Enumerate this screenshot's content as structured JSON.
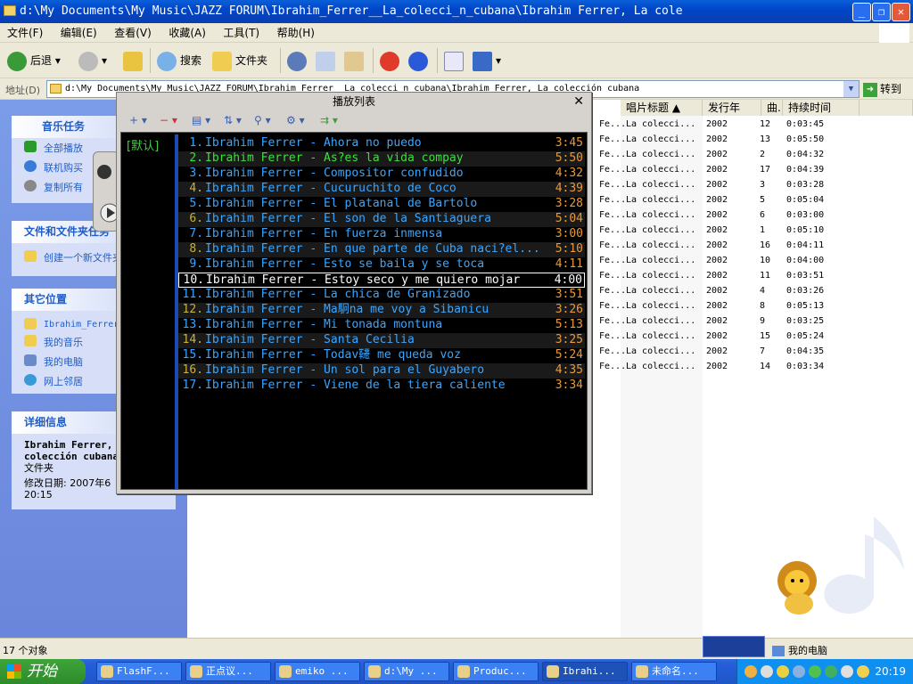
{
  "window": {
    "title": "d:\\My Documents\\My Music\\JAZZ FORUM\\Ibrahim_Ferrer__La_colecci_n_cubana\\Ibrahim Ferrer, La cole",
    "buttons": {
      "min": "_",
      "max": "❐",
      "close": "✕"
    }
  },
  "menu": [
    "文件(F)",
    "编辑(E)",
    "查看(V)",
    "收藏(A)",
    "工具(T)",
    "帮助(H)"
  ],
  "toolbar": {
    "back": "后退",
    "search": "搜索",
    "folders": "文件夹"
  },
  "address": {
    "label": "地址(D)",
    "value": "d:\\My Documents\\My Music\\JAZZ FORUM\\Ibrahim_Ferrer__La_colecci_n_cubana\\Ibrahim Ferrer, La colección cubana",
    "go": "转到"
  },
  "taskpane": {
    "music_tasks": {
      "title": "音乐任务",
      "items": [
        "全部播放",
        "联机购买",
        "复制所有"
      ]
    },
    "file_tasks": {
      "title": "文件和文件夹任务",
      "items": [
        "创建一个新文件夹"
      ]
    },
    "other_places": {
      "title": "其它位置",
      "items": [
        "Ibrahim_Ferrer",
        "我的音乐",
        "我的电脑",
        "网上邻居"
      ]
    },
    "details": {
      "title": "详细信息",
      "name": "Ibrahim Ferrer, La colección cubana",
      "type": "文件夹",
      "modified": "修改日期: 2007年6",
      "time": "20:15"
    }
  },
  "columns": {
    "album": "唱片标题",
    "year": "发行年",
    "track": "曲.",
    "duration": "持续时间"
  },
  "rows": [
    {
      "artist": "Fe...",
      "album": "La colecci...",
      "year": "2002",
      "track": "12",
      "duration": "0:03:45"
    },
    {
      "artist": "Fe...",
      "album": "La colecci...",
      "year": "2002",
      "track": "13",
      "duration": "0:05:50"
    },
    {
      "artist": "Fe...",
      "album": "La colecci...",
      "year": "2002",
      "track": "2",
      "duration": "0:04:32"
    },
    {
      "artist": "Fe...",
      "album": "La colecci...",
      "year": "2002",
      "track": "17",
      "duration": "0:04:39"
    },
    {
      "artist": "Fe...",
      "album": "La colecci...",
      "year": "2002",
      "track": "3",
      "duration": "0:03:28"
    },
    {
      "artist": "Fe...",
      "album": "La colecci...",
      "year": "2002",
      "track": "5",
      "duration": "0:05:04"
    },
    {
      "artist": "Fe...",
      "album": "La colecci...",
      "year": "2002",
      "track": "6",
      "duration": "0:03:00"
    },
    {
      "artist": "Fe...",
      "album": "La colecci...",
      "year": "2002",
      "track": "1",
      "duration": "0:05:10"
    },
    {
      "artist": "Fe...",
      "album": "La colecci...",
      "year": "2002",
      "track": "16",
      "duration": "0:04:11"
    },
    {
      "artist": "Fe...",
      "album": "La colecci...",
      "year": "2002",
      "track": "10",
      "duration": "0:04:00"
    },
    {
      "artist": "Fe...",
      "album": "La colecci...",
      "year": "2002",
      "track": "11",
      "duration": "0:03:51"
    },
    {
      "artist": "Fe...",
      "album": "La colecci...",
      "year": "2002",
      "track": "4",
      "duration": "0:03:26"
    },
    {
      "artist": "Fe...",
      "album": "La colecci...",
      "year": "2002",
      "track": "8",
      "duration": "0:05:13"
    },
    {
      "artist": "Fe...",
      "album": "La colecci...",
      "year": "2002",
      "track": "9",
      "duration": "0:03:25"
    },
    {
      "artist": "Fe...",
      "album": "La colecci...",
      "year": "2002",
      "track": "15",
      "duration": "0:05:24"
    },
    {
      "artist": "Fe...",
      "album": "La colecci...",
      "year": "2002",
      "track": "7",
      "duration": "0:04:35"
    },
    {
      "artist": "Fe...",
      "album": "La colecci...",
      "year": "2002",
      "track": "14",
      "duration": "0:03:34"
    }
  ],
  "playlist": {
    "title": "播放列表",
    "close": "✕",
    "group": "[默认]",
    "tools": [
      "+ ▾",
      "− ▾",
      "▤ ▾",
      "⇅ ▾",
      "⚲ ▾",
      "⚙ ▾",
      "⇉ ▾"
    ],
    "playing_index": 1,
    "selected_index": 9,
    "items": [
      {
        "num": "1.",
        "title": "Ibrahim Ferrer - Ahora no puedo",
        "dur": "3:45"
      },
      {
        "num": "2.",
        "title": "Ibrahim Ferrer - As?es la vida compay",
        "dur": "5:50"
      },
      {
        "num": "3.",
        "title": "Ibrahim Ferrer - Compositor confudido",
        "dur": "4:32"
      },
      {
        "num": "4.",
        "title": "Ibrahim Ferrer - Cucuruchito de Coco",
        "dur": "4:39"
      },
      {
        "num": "5.",
        "title": "Ibrahim Ferrer - El platanal de Bartolo",
        "dur": "3:28"
      },
      {
        "num": "6.",
        "title": "Ibrahim Ferrer - El son de la Santiaguera",
        "dur": "5:04"
      },
      {
        "num": "7.",
        "title": "Ibrahim Ferrer - En fuerza inmensa",
        "dur": "3:00"
      },
      {
        "num": "8.",
        "title": "Ibrahim Ferrer - En que parte de Cuba naci?el...",
        "dur": "5:10"
      },
      {
        "num": "9.",
        "title": "Ibrahim Ferrer - Esto se baila y se toca",
        "dur": "4:11"
      },
      {
        "num": "10.",
        "title": "Ibrahim Ferrer - Estoy seco y me quiero mojar",
        "dur": "4:00"
      },
      {
        "num": "11.",
        "title": "Ibrahim Ferrer - La chica de Granizado",
        "dur": "3:51"
      },
      {
        "num": "12.",
        "title": "Ibrahim Ferrer - Ma駉na me voy a Sibanicu",
        "dur": "3:26"
      },
      {
        "num": "13.",
        "title": "Ibrahim Ferrer - Mi tonada montuna",
        "dur": "5:13"
      },
      {
        "num": "14.",
        "title": "Ibrahim Ferrer - Santa Cecilia",
        "dur": "3:25"
      },
      {
        "num": "15.",
        "title": "Ibrahim Ferrer - Todav韆 me queda voz",
        "dur": "5:24"
      },
      {
        "num": "16.",
        "title": "Ibrahim Ferrer - Un sol para el Guyabero",
        "dur": "4:35"
      },
      {
        "num": "17.",
        "title": "Ibrahim Ferrer - Viene de la tiera caliente",
        "dur": "3:34"
      }
    ]
  },
  "status": {
    "count": "17 个对象",
    "computer": "我的电脑"
  },
  "taskbar": {
    "start": "开始",
    "tasks": [
      "FlashF...",
      "正点议...",
      "emiko ...",
      "d:\\My ...",
      "Produc...",
      "Ibrahi...",
      "未命名..."
    ],
    "active_index": 5,
    "clock": "20:19"
  },
  "colors": {
    "accent": "#0a5fd8",
    "playlist_text": "#3aa6ff",
    "playing": "#3ce03c",
    "duration": "#e89a3a"
  }
}
